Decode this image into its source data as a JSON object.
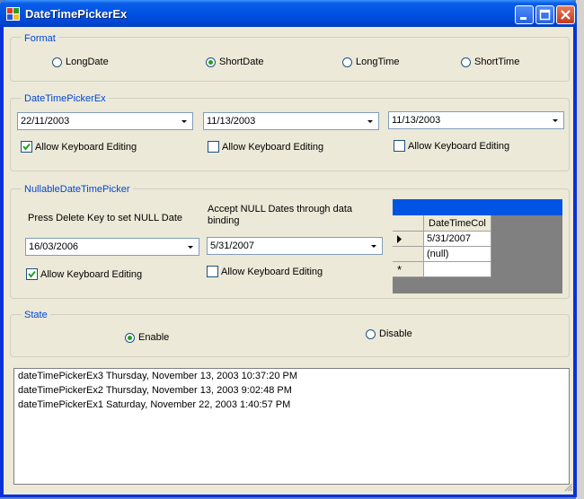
{
  "window": {
    "title": "DateTimePickerEx"
  },
  "format_group": {
    "label": "Format",
    "options": [
      {
        "label": "LongDate",
        "selected": false
      },
      {
        "label": "ShortDate",
        "selected": true
      },
      {
        "label": "LongTime",
        "selected": false
      },
      {
        "label": "ShortTime",
        "selected": false
      }
    ]
  },
  "dtpex_group": {
    "label": "DateTimePickerEx",
    "pickers": [
      {
        "value": "22/11/2003",
        "keyboard_label": "Allow Keyboard Editing",
        "checked": true
      },
      {
        "value": "11/13/2003",
        "keyboard_label": "Allow Keyboard Editing",
        "checked": false
      },
      {
        "value": "11/13/2003",
        "keyboard_label": "Allow Keyboard Editing",
        "checked": false
      }
    ]
  },
  "nullable_group": {
    "label": "NullableDateTimePicker",
    "left_caption": "Press Delete Key to set NULL Date",
    "right_caption": "Accept NULL Dates through data binding",
    "left_picker": {
      "value": "16/03/2006",
      "keyboard_label": "Allow Keyboard Editing",
      "checked": true
    },
    "right_picker": {
      "value": "5/31/2007",
      "keyboard_label": "Allow Keyboard Editing",
      "checked": false
    },
    "grid": {
      "column": "DateTimeCol",
      "rows": [
        "5/31/2007",
        "(null)"
      ],
      "new_row_marker": "*"
    }
  },
  "state_group": {
    "label": "State",
    "options": [
      {
        "label": "Enable",
        "selected": true
      },
      {
        "label": "Disable",
        "selected": false
      }
    ]
  },
  "log": {
    "lines": [
      "dateTimePickerEx3 Thursday, November 13, 2003 10:37:20 PM",
      "dateTimePickerEx2 Thursday, November 13, 2003 9:02:48 PM",
      "dateTimePickerEx1 Saturday, November 22, 2003 1:40:57 PM"
    ]
  }
}
